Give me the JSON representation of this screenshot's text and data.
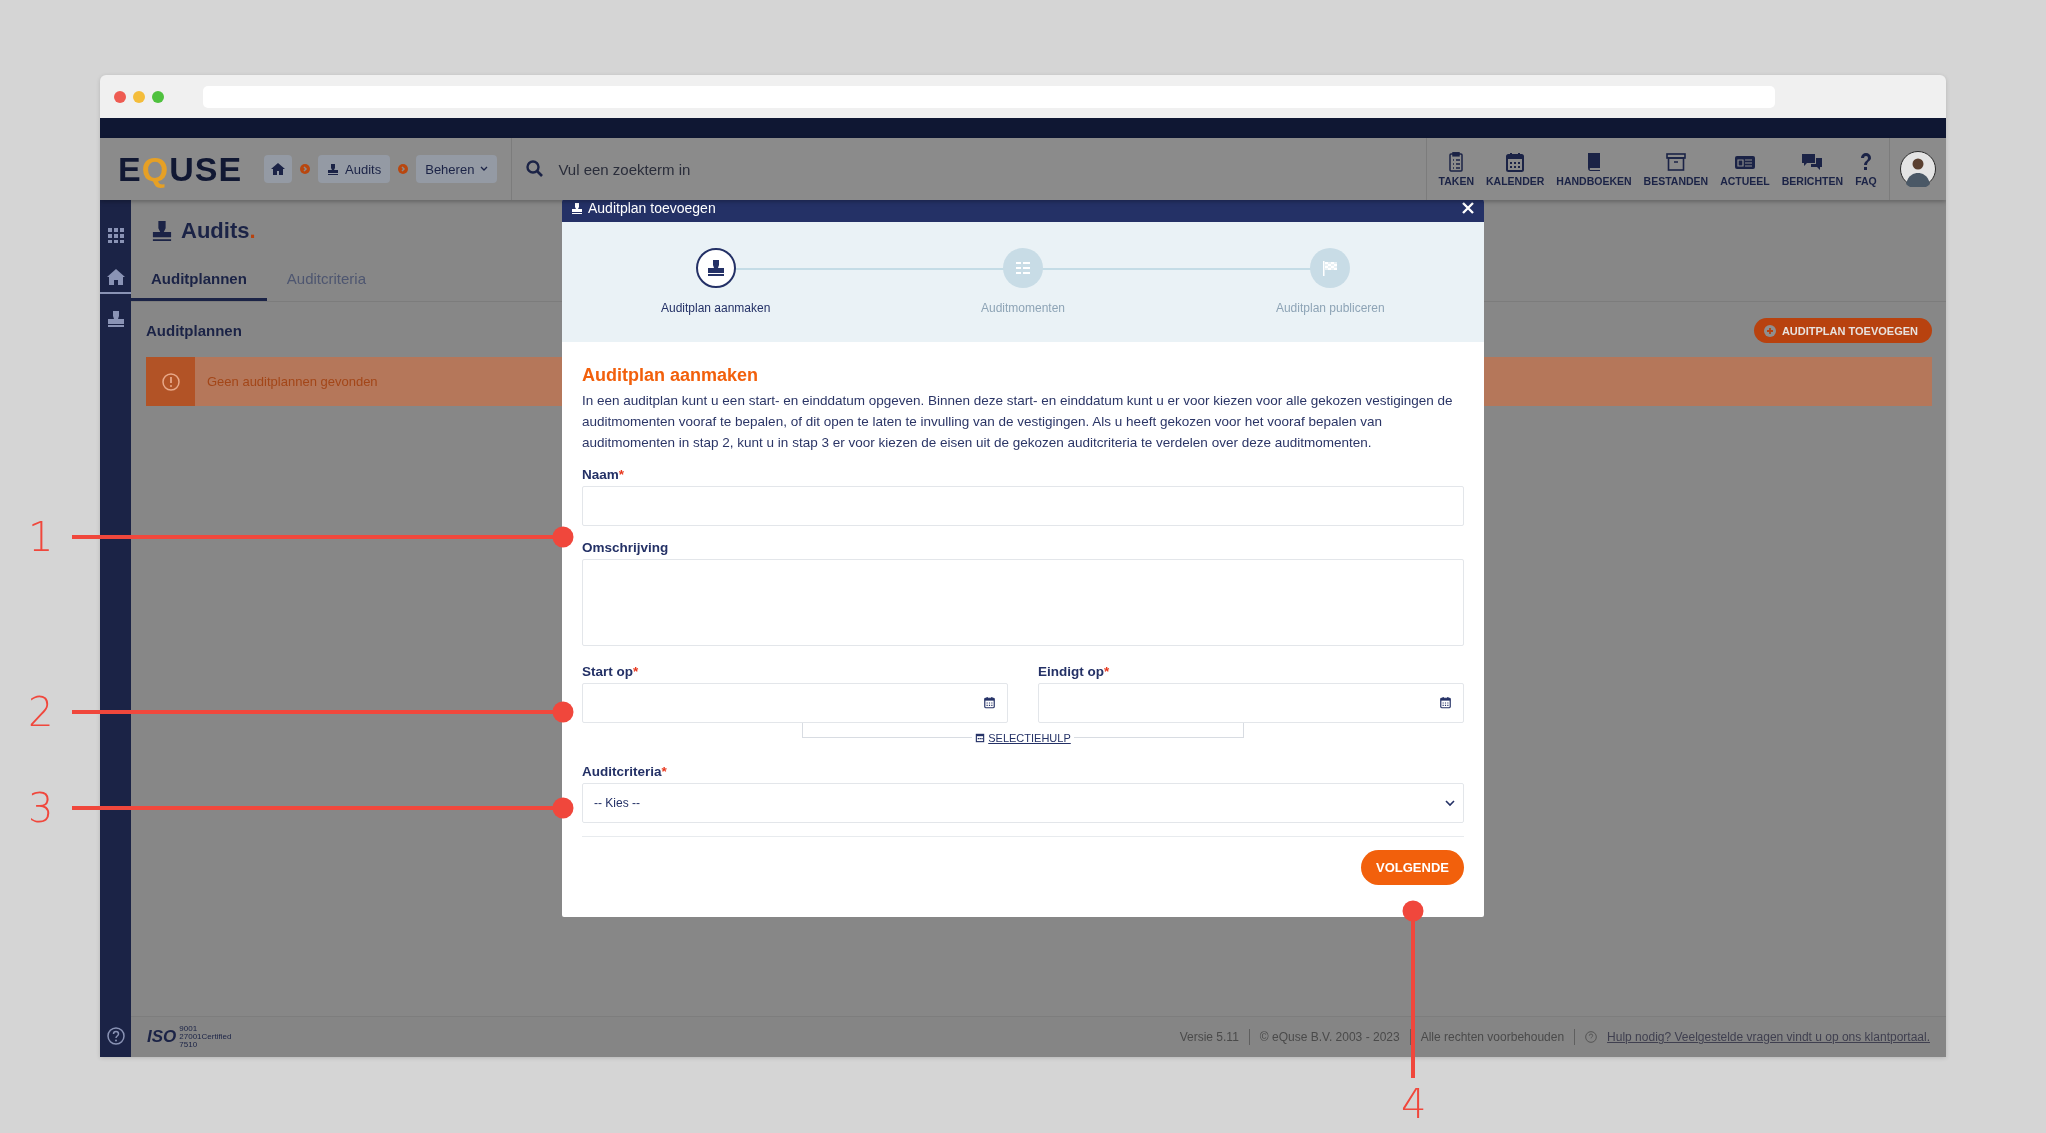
{
  "header": {
    "logo": "EQUSE",
    "breadcrumb": [
      {
        "kind": "home"
      },
      {
        "kind": "link",
        "label": "Audits"
      },
      {
        "kind": "dropdown",
        "label": "Beheren"
      }
    ],
    "search": {
      "placeholder": "Vul een zoekterm in"
    },
    "nav": [
      {
        "label": "TAKEN"
      },
      {
        "label": "KALENDER"
      },
      {
        "label": "HANDBOEKEN"
      },
      {
        "label": "BESTANDEN"
      },
      {
        "label": "ACTUEEL"
      },
      {
        "label": "BERICHTEN"
      },
      {
        "label": "FAQ"
      }
    ]
  },
  "sidebar": {
    "items": [
      {
        "selected": false
      },
      {
        "selected": true
      },
      {
        "selected": false
      }
    ]
  },
  "page": {
    "title": "Audits.",
    "tabs": [
      {
        "label": "Auditplannen",
        "selected": true
      },
      {
        "label": "Auditcriteria",
        "selected": false
      }
    ],
    "section_title": "Auditplannen",
    "add_button": "AUDITPLAN TOEVOEGEN",
    "alert": "Geen auditplannen gevonden"
  },
  "footer": {
    "iso": {
      "logo": "ISO",
      "lines": [
        "9001",
        "27001Certified",
        "7510"
      ]
    },
    "version": "Versie 5.11",
    "copyright": "© eQuse B.V. 2003 - 2023",
    "rights": "Alle rechten voorbehouden",
    "help_link": "Hulp nodig? Veelgestelde vragen vindt u op ons klantportaal."
  },
  "modal": {
    "title": "Auditplan toevoegen",
    "steps": [
      {
        "label": "Auditplan aanmaken",
        "selected": true
      },
      {
        "label": "Auditmomenten",
        "selected": false
      },
      {
        "label": "Auditplan publiceren",
        "selected": false
      }
    ],
    "heading": "Auditplan aanmaken",
    "intro": "In een auditplan kunt u een start- en einddatum opgeven. Binnen deze start- en einddatum kunt u er voor kiezen voor alle gekozen vestigingen de auditmomenten vooraf te bepalen, of dit open te laten te invulling van de vestigingen. Als u heeft gekozen voor het vooraf bepalen van auditmomenten in stap 2, kunt u in stap 3 er voor kiezen de eisen uit de gekozen auditcriteria te verdelen over deze auditmomenten.",
    "fields": [
      {
        "kind": "text",
        "label": "Naam",
        "mark": "*"
      },
      {
        "kind": "textarea",
        "label": "Omschrijving"
      }
    ],
    "date_fields": [
      {
        "label": "Start op",
        "mark": "*"
      },
      {
        "label": "Eindigt op",
        "mark": "*"
      }
    ],
    "selection_help": "SELECTIEHULP",
    "criteria": {
      "label": "Auditcriteria",
      "mark": "*",
      "value": "-- Kies --"
    },
    "next_button": "VOLGENDE"
  },
  "annotations": [
    {
      "label": "1",
      "kind": "left"
    },
    {
      "label": "2",
      "kind": "left"
    },
    {
      "label": "3",
      "kind": "left"
    },
    {
      "label": "4",
      "kind": "bottom"
    }
  ]
}
